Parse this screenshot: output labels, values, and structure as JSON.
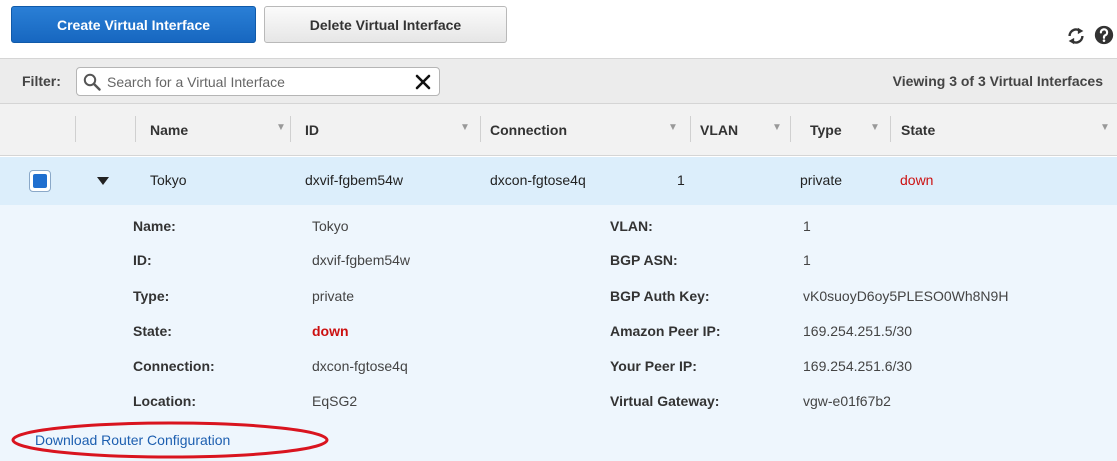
{
  "toolbar": {
    "create_label": "Create Virtual Interface",
    "delete_label": "Delete Virtual Interface"
  },
  "filter": {
    "label": "Filter:",
    "placeholder": "Search for a Virtual Interface",
    "value": "",
    "viewing": "Viewing 3 of 3 Virtual Interfaces"
  },
  "columns": [
    "Name",
    "ID",
    "Connection",
    "VLAN",
    "Type",
    "State"
  ],
  "row": {
    "name": "Tokyo",
    "id": "dxvif-fgbem54w",
    "connection": "dxcon-fgtose4q",
    "vlan": "1",
    "type": "private",
    "state": "down"
  },
  "details": {
    "left": [
      {
        "label": "Name:",
        "value": "Tokyo"
      },
      {
        "label": "ID:",
        "value": "dxvif-fgbem54w"
      },
      {
        "label": "Type:",
        "value": "private"
      },
      {
        "label": "State:",
        "value": "down"
      },
      {
        "label": "Connection:",
        "value": "dxcon-fgtose4q"
      },
      {
        "label": "Location:",
        "value": "EqSG2"
      }
    ],
    "right": [
      {
        "label": "VLAN:",
        "value": "1"
      },
      {
        "label": "BGP ASN:",
        "value": "1"
      },
      {
        "label": "BGP Auth Key:",
        "value": "vK0suoyD6oy5PLESO0Wh8N9H"
      },
      {
        "label": "Amazon Peer IP:",
        "value": "169.254.251.5/30"
      },
      {
        "label": "Your Peer IP:",
        "value": "169.254.251.6/30"
      },
      {
        "label": "Virtual Gateway:",
        "value": "vgw-e01f67b2"
      }
    ],
    "download_link": "Download Router Configuration"
  },
  "colors": {
    "primary": "#1f6fcf",
    "state_down": "#cc1111",
    "selected_row": "#dceefb",
    "annotation": "#d9141f"
  },
  "icons": [
    "refresh-icon",
    "help-icon",
    "search-icon",
    "clear-icon",
    "expand-icon"
  ]
}
